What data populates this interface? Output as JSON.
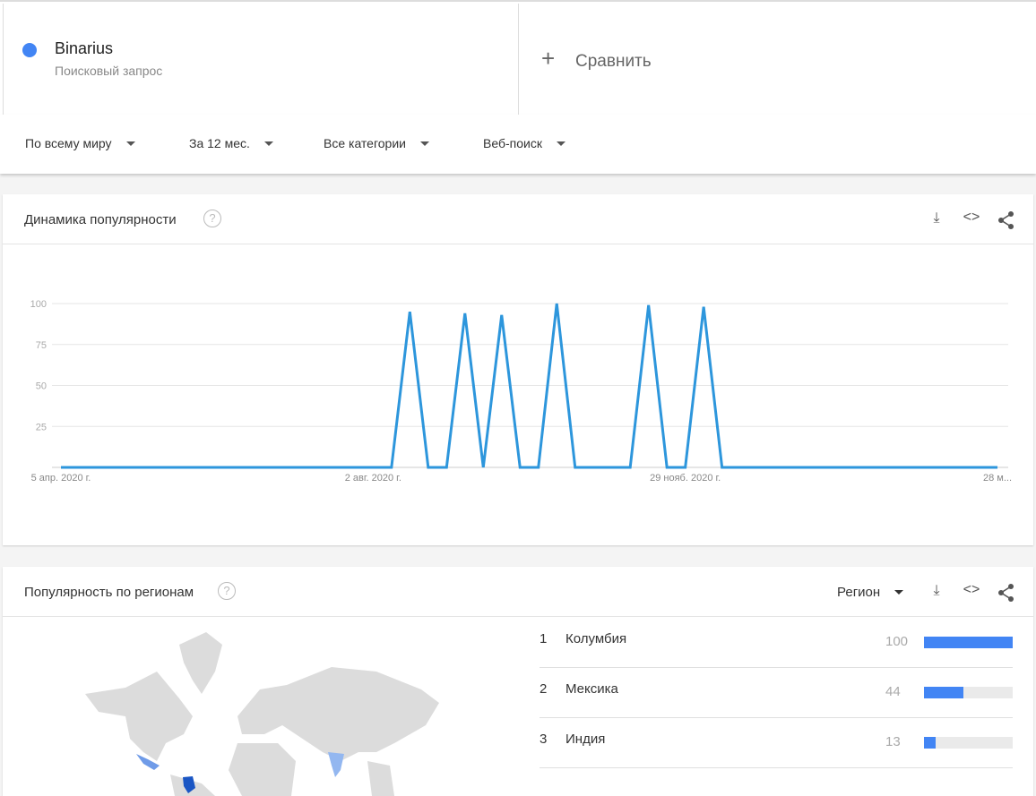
{
  "search_term": {
    "name": "Binarius",
    "type": "Поисковый запрос",
    "color": "#4285f4"
  },
  "compare": {
    "label": "Сравнить"
  },
  "filters": [
    "По всему миру",
    "За 12 мес.",
    "Все категории",
    "Веб-поиск"
  ],
  "interest_over_time": {
    "title": "Динамика популярности"
  },
  "chart_data": {
    "type": "line",
    "title": "Динамика популярности",
    "x_tick_labels": [
      "5 апр. 2020 г.",
      "2 авг. 2020 г.",
      "29 нояб. 2020 г.",
      "28 м..."
    ],
    "x_tick_weeks": [
      0,
      17,
      34,
      51
    ],
    "y_ticks": [
      25,
      50,
      75,
      100
    ],
    "ylim": [
      0,
      100
    ],
    "series": [
      {
        "name": "Binarius",
        "color": "#2d96dc",
        "values": [
          0,
          0,
          0,
          0,
          0,
          0,
          0,
          0,
          0,
          0,
          0,
          0,
          0,
          0,
          0,
          0,
          0,
          0,
          0,
          95,
          0,
          0,
          94,
          0,
          93,
          0,
          0,
          100,
          0,
          0,
          0,
          0,
          99,
          0,
          0,
          98,
          0,
          0,
          0,
          0,
          0,
          0,
          0,
          0,
          0,
          0,
          0,
          0,
          0,
          0,
          0,
          0
        ]
      }
    ]
  },
  "interest_by_region": {
    "title": "Популярность по регионам",
    "resolution": "Регион",
    "rows": [
      {
        "rank": "1",
        "name": "Колумбия",
        "value": 100
      },
      {
        "rank": "2",
        "name": "Мексика",
        "value": 44
      },
      {
        "rank": "3",
        "name": "Индия",
        "value": 13
      }
    ]
  }
}
